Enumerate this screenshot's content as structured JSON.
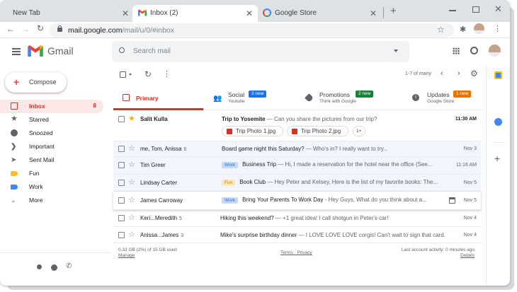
{
  "browser": {
    "tabs": [
      {
        "title": "New Tab"
      },
      {
        "title": "Inbox (2)"
      },
      {
        "title": "Google Store"
      }
    ],
    "url_host": "mail.google.com",
    "url_path": "/mail/u/0/#inbox"
  },
  "header": {
    "app_name": "Gmail",
    "search_placeholder": "Search mail"
  },
  "sidebar": {
    "compose_label": "Compose",
    "items": [
      {
        "label": "Inbox",
        "count": "8",
        "icon": "inbox-icon"
      },
      {
        "label": "Starred",
        "count": "",
        "icon": "star-icon"
      },
      {
        "label": "Snoozed",
        "count": "",
        "icon": "clock-icon"
      },
      {
        "label": "Important",
        "count": "",
        "icon": "important-icon"
      },
      {
        "label": "Sent Mail",
        "count": "",
        "icon": "send-icon"
      },
      {
        "label": "Fun",
        "count": "",
        "icon": "label-icon",
        "color": "#f6bf26"
      },
      {
        "label": "Work",
        "count": "",
        "icon": "label-icon",
        "color": "#4285f4"
      },
      {
        "label": "More",
        "count": "",
        "icon": "chevron-down-icon"
      }
    ]
  },
  "toolbar": {
    "pagination": "1-7 of many"
  },
  "categories": [
    {
      "title": "Primary",
      "subtitle": "",
      "badge": "",
      "color": "#d93025"
    },
    {
      "title": "Social",
      "subtitle": "Youtube",
      "badge": "2 new",
      "color": "#1a73e8"
    },
    {
      "title": "Promotions",
      "subtitle": "Think with Google",
      "badge": "2 new",
      "color": "#188038"
    },
    {
      "title": "Updates",
      "subtitle": "Google Store",
      "badge": "1 new",
      "color": "#e37400"
    }
  ],
  "emails": [
    {
      "sender": "Salit Kulla",
      "count": "",
      "label": "",
      "subject": "Trip to Yosemite",
      "snippet": " — Can you share the pictures from our trip?",
      "date": "11:30 AM",
      "unread": true,
      "starred": true,
      "attachments": [
        "Trip Photo 1.jpg",
        "Trip Photo 2.jpg",
        "1+"
      ]
    },
    {
      "sender": "me, Tom, Anissa",
      "count": "6",
      "label": "",
      "subject": "Board game night this Saturday?",
      "snippet": " — Who's in? I really want to try...",
      "date": "Nov 3",
      "unread": false,
      "starred": false
    },
    {
      "sender": "Tim Greer",
      "count": "",
      "label": "Work",
      "subject": "Business Trip",
      "snippet": " — Hi, I made a reservation for the hotel near the office (See...",
      "date": "11:16 AM",
      "unread": false,
      "starred": false
    },
    {
      "sender": "Lindsay Carter",
      "count": "",
      "label": "Fun",
      "subject": "Book Club",
      "snippet": " — Hey Peter and Kelsey, Here is the list of my favorite books: The...",
      "date": "Nov 5",
      "unread": false,
      "starred": false
    },
    {
      "sender": "James Carroway",
      "count": "",
      "label": "Work",
      "subject": "Bring Your Parents To Work Day",
      "snippet": " - Hey Guys, What do you think about a...",
      "date": "Nov 5",
      "unread": false,
      "starred": false
    },
    {
      "sender": "Keri...Meredith",
      "count": "5",
      "label": "",
      "subject": "Hiking this weekend?",
      "snippet": " — +1 great idea! I call shotgun in Peter's car!",
      "date": "Nov 4",
      "unread": false,
      "starred": false
    },
    {
      "sender": "Anissa...James",
      "count": "3",
      "label": "",
      "subject": "Mike's surprise birthday dinner",
      "snippet": " — I LOVE LOVE LOVE corgis! Can't wait to sign that card.",
      "date": "Nov 4",
      "unread": false,
      "starred": false
    }
  ],
  "footer": {
    "storage": "0.33 GB (2%) of 15 GB used",
    "manage": "Manage",
    "terms": "Terms · Privacy",
    "activity": "Last account activity: 0 minutes ago",
    "details": "Details"
  },
  "colors": {
    "accent_red": "#d93025",
    "inbox_bg": "#fce8e6",
    "blue": "#1a73e8"
  }
}
